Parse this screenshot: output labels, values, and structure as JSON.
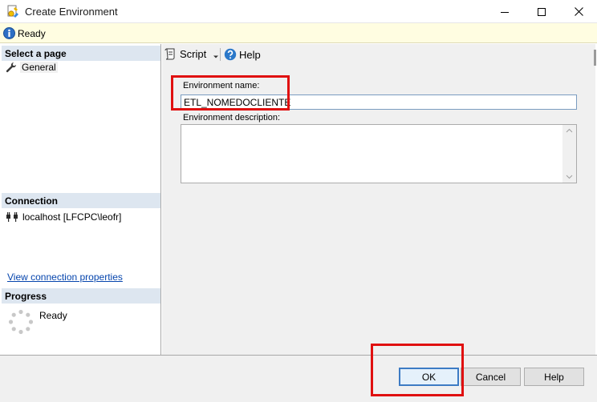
{
  "window": {
    "title": "Create Environment"
  },
  "status": {
    "text": "Ready"
  },
  "left_pane": {
    "select_page_header": "Select a page",
    "pages": [
      {
        "label": "General",
        "icon": "wrench-icon"
      }
    ],
    "connection_header": "Connection",
    "connection_server": "localhost [LFCPC\\leofr]",
    "view_connection_properties": "View connection properties",
    "progress_header": "Progress",
    "progress_status": "Ready"
  },
  "toolbar": {
    "script_label": "Script",
    "help_label": "Help"
  },
  "form": {
    "name_label": "Environment name:",
    "name_value": "ETL_NOMEDOCLIENTE",
    "description_label": "Environment description:",
    "description_value": ""
  },
  "buttons": {
    "ok": "OK",
    "cancel": "Cancel",
    "help": "Help"
  },
  "colors": {
    "accent": "#3d7bc4",
    "status_bg": "#fffde1",
    "section_header_bg": "#dde6f0",
    "highlight_red": "#e01010",
    "link": "#0645ad"
  }
}
